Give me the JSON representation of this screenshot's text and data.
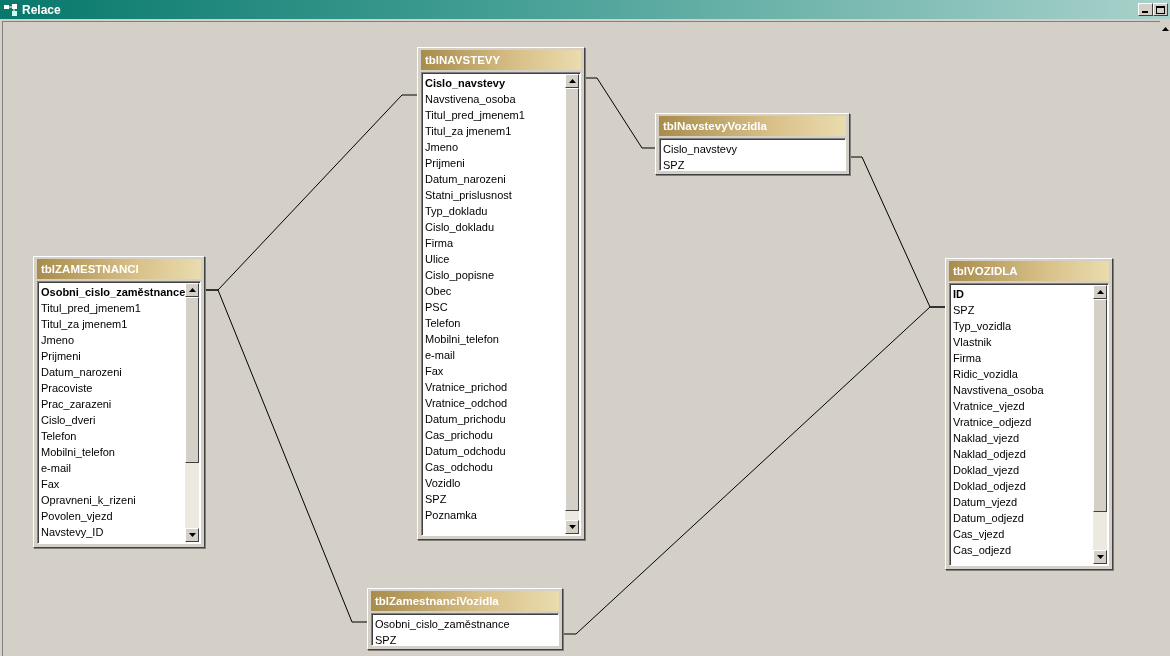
{
  "window": {
    "title": "Relace"
  },
  "tables": [
    {
      "name": "tblZAMESTNANCI",
      "fields": [
        {
          "name": "Osobni_cislo_zaměstnance",
          "key": true
        },
        {
          "name": "Titul_pred_jmenem1",
          "key": false
        },
        {
          "name": "Titul_za jmenem1",
          "key": false
        },
        {
          "name": "Jmeno",
          "key": false
        },
        {
          "name": "Prijmeni",
          "key": false
        },
        {
          "name": "Datum_narozeni",
          "key": false
        },
        {
          "name": "Pracoviste",
          "key": false
        },
        {
          "name": "Prac_zarazeni",
          "key": false
        },
        {
          "name": "Cislo_dveri",
          "key": false
        },
        {
          "name": "Telefon",
          "key": false
        },
        {
          "name": "Mobilni_telefon",
          "key": false
        },
        {
          "name": "e-mail",
          "key": false
        },
        {
          "name": "Fax",
          "key": false
        },
        {
          "name": "Opravneni_k_rizeni",
          "key": false
        },
        {
          "name": "Povolen_vjezd",
          "key": false
        },
        {
          "name": "Navstevy_ID",
          "key": false
        }
      ]
    },
    {
      "name": "tblNAVSTEVY",
      "fields": [
        {
          "name": "Cislo_navstevy",
          "key": true
        },
        {
          "name": "Navstivena_osoba",
          "key": false
        },
        {
          "name": "Titul_pred_jmenem1",
          "key": false
        },
        {
          "name": "Titul_za jmenem1",
          "key": false
        },
        {
          "name": "Jmeno",
          "key": false
        },
        {
          "name": "Prijmeni",
          "key": false
        },
        {
          "name": "Datum_narozeni",
          "key": false
        },
        {
          "name": "Statni_prislusnost",
          "key": false
        },
        {
          "name": "Typ_dokladu",
          "key": false
        },
        {
          "name": "Cislo_dokladu",
          "key": false
        },
        {
          "name": "Firma",
          "key": false
        },
        {
          "name": "Ulice",
          "key": false
        },
        {
          "name": "Cislo_popisne",
          "key": false
        },
        {
          "name": "Obec",
          "key": false
        },
        {
          "name": "PSC",
          "key": false
        },
        {
          "name": "Telefon",
          "key": false
        },
        {
          "name": "Mobilni_telefon",
          "key": false
        },
        {
          "name": "e-mail",
          "key": false
        },
        {
          "name": "Fax",
          "key": false
        },
        {
          "name": "Vratnice_prichod",
          "key": false
        },
        {
          "name": "Vratnice_odchod",
          "key": false
        },
        {
          "name": "Datum_prichodu",
          "key": false
        },
        {
          "name": "Cas_prichodu",
          "key": false
        },
        {
          "name": "Datum_odchodu",
          "key": false
        },
        {
          "name": "Cas_odchodu",
          "key": false
        },
        {
          "name": "Vozidlo",
          "key": false
        },
        {
          "name": "SPZ",
          "key": false
        },
        {
          "name": "Poznamka",
          "key": false
        }
      ]
    },
    {
      "name": "tblNavstevyVozidla",
      "fields": [
        {
          "name": "Cislo_navstevy",
          "key": false
        },
        {
          "name": "SPZ",
          "key": false
        }
      ]
    },
    {
      "name": "tblVOZIDLA",
      "fields": [
        {
          "name": "ID",
          "key": true
        },
        {
          "name": "SPZ",
          "key": false
        },
        {
          "name": "Typ_vozidla",
          "key": false
        },
        {
          "name": "Vlastnik",
          "key": false
        },
        {
          "name": "Firma",
          "key": false
        },
        {
          "name": "Ridic_vozidla",
          "key": false
        },
        {
          "name": "Navstivena_osoba",
          "key": false
        },
        {
          "name": "Vratnice_vjezd",
          "key": false
        },
        {
          "name": "Vratnice_odjezd",
          "key": false
        },
        {
          "name": "Naklad_vjezd",
          "key": false
        },
        {
          "name": "Naklad_odjezd",
          "key": false
        },
        {
          "name": "Doklad_vjezd",
          "key": false
        },
        {
          "name": "Doklad_odjezd",
          "key": false
        },
        {
          "name": "Datum_vjezd",
          "key": false
        },
        {
          "name": "Datum_odjezd",
          "key": false
        },
        {
          "name": "Cas_vjezd",
          "key": false
        },
        {
          "name": "Cas_odjezd",
          "key": false
        }
      ]
    },
    {
      "name": "tblZamestnanciVozidla",
      "fields": [
        {
          "name": "Osobni_cislo_zaměstnance",
          "key": false
        },
        {
          "name": "SPZ",
          "key": false
        }
      ]
    }
  ]
}
